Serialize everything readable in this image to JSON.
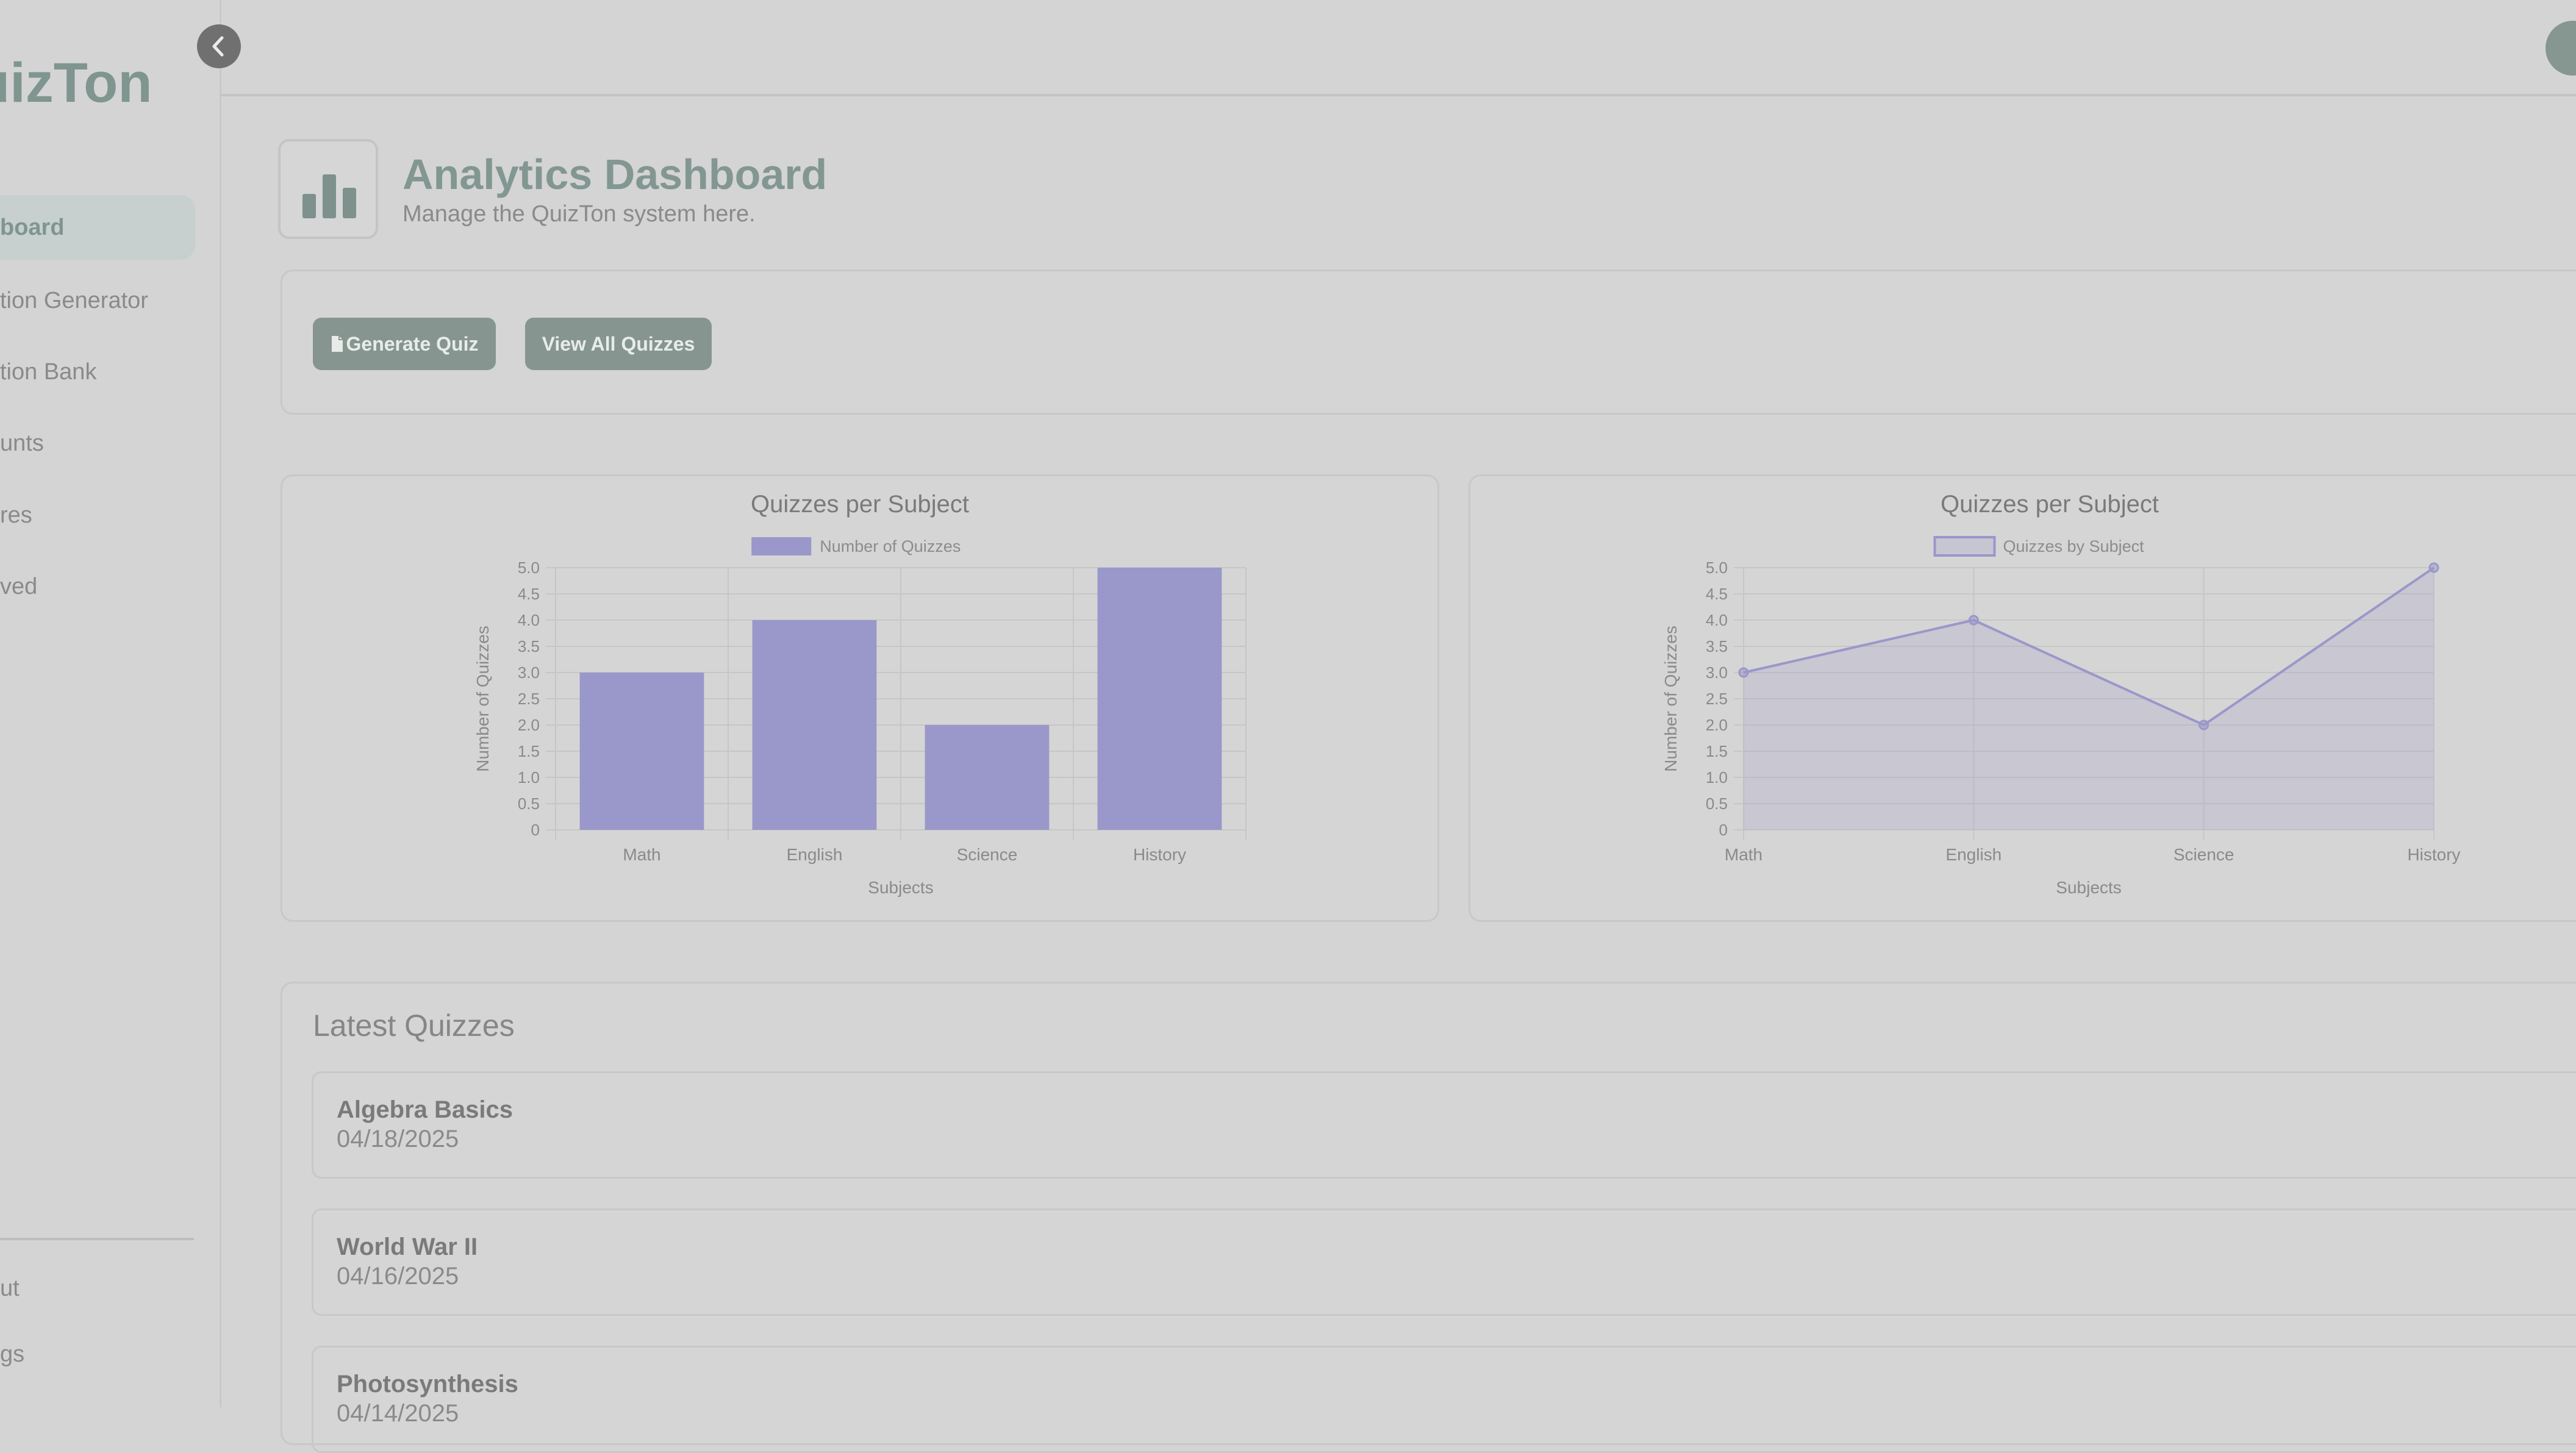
{
  "sidebar": {
    "brand": "uizTon",
    "items": [
      {
        "label": "board",
        "active": true
      },
      {
        "label": "tion Generator"
      },
      {
        "label": "tion Bank"
      },
      {
        "label": "unts"
      },
      {
        "label": "res"
      },
      {
        "label": "ved"
      }
    ],
    "footer_items": [
      {
        "label": "ut"
      },
      {
        "label": "gs"
      }
    ],
    "collapse_icon": "chevron-left-icon"
  },
  "header": {
    "title": "Analytics Dashboard",
    "subtitle": "Manage the QuizTon system here.",
    "icon": "bar-chart-icon"
  },
  "actions": {
    "generate_label": "Generate Quiz",
    "generate_icon": "document-icon",
    "view_all_label": "View All Quizzes"
  },
  "chart_data": [
    {
      "type": "bar",
      "title": "Quizzes per Subject",
      "categories": [
        "Math",
        "English",
        "Science",
        "History"
      ],
      "series": [
        {
          "name": "Number of Quizzes",
          "values": [
            3,
            4,
            2,
            5
          ]
        }
      ],
      "xlabel": "Subjects",
      "ylabel": "Number of Quizzes",
      "ylim": [
        0,
        5
      ],
      "yticks": [
        "0",
        "0.5",
        "1.0",
        "1.5",
        "2.0",
        "2.5",
        "3.0",
        "3.5",
        "4.0",
        "4.5",
        "5.0"
      ],
      "grid": true,
      "legend": "top",
      "color": "#9a97ca"
    },
    {
      "type": "area",
      "title": "Quizzes per Subject",
      "categories": [
        "Math",
        "English",
        "Science",
        "History"
      ],
      "series": [
        {
          "name": "Quizzes by Subject",
          "values": [
            3,
            4,
            2,
            5
          ]
        }
      ],
      "xlabel": "Subjects",
      "ylabel": "Number of Quizzes",
      "ylim": [
        0,
        5
      ],
      "yticks": [
        "0",
        "0.5",
        "1.0",
        "1.5",
        "2.0",
        "2.5",
        "3.0",
        "3.5",
        "4.0",
        "4.5",
        "5.0"
      ],
      "grid": true,
      "legend": "top",
      "color": "#9a97ca"
    }
  ],
  "latest": {
    "title": "Latest Quizzes",
    "items": [
      {
        "name": "Algebra Basics",
        "date": "04/18/2025"
      },
      {
        "name": "World War II",
        "date": "04/16/2025"
      },
      {
        "name": "Photosynthesis",
        "date": "04/14/2025"
      }
    ]
  },
  "colors": {
    "accent": "#869590",
    "chart": "#9a97ca",
    "background": "#d4d4d4"
  }
}
